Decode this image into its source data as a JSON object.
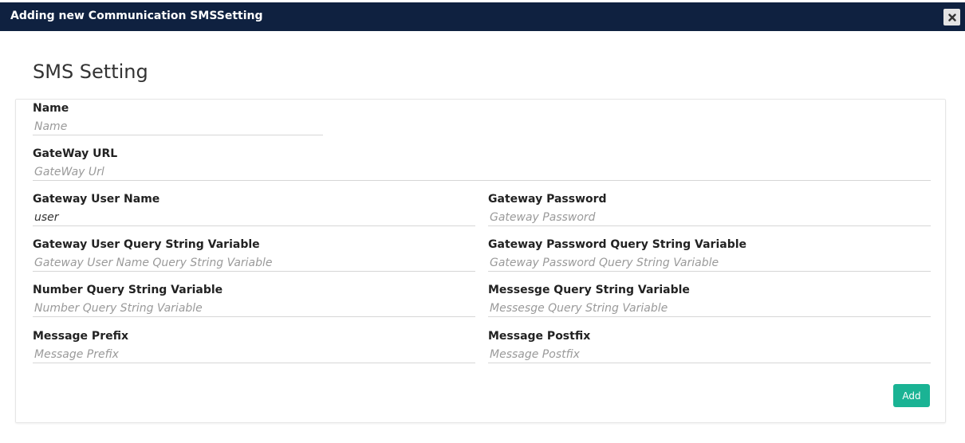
{
  "dialog": {
    "title": "Adding new Communication SMSSetting",
    "close_icon": "close-icon"
  },
  "page_title": "SMS Setting",
  "form": {
    "name": {
      "label": "Name",
      "value": "",
      "placeholder": "Name"
    },
    "gateway_url": {
      "label": "GateWay URL",
      "value": "",
      "placeholder": "GateWay Url"
    },
    "gateway_user_name": {
      "label": "Gateway User Name",
      "value": "user",
      "placeholder": ""
    },
    "gateway_password": {
      "label": "Gateway Password",
      "value": "",
      "placeholder": "Gateway Password"
    },
    "gateway_user_query": {
      "label": "Gateway User Query String Variable",
      "value": "",
      "placeholder": "Gateway User Name Query String Variable"
    },
    "gateway_password_query": {
      "label": "Gateway Password Query String Variable",
      "value": "",
      "placeholder": "Gateway Password Query String Variable"
    },
    "number_query": {
      "label": "Number Query String Variable",
      "value": "",
      "placeholder": "Number Query String Variable"
    },
    "message_query": {
      "label": "Messesge Query String Variable",
      "value": "",
      "placeholder": "Messesge Query String Variable"
    },
    "message_prefix": {
      "label": "Message Prefix",
      "value": "",
      "placeholder": "Message Prefix"
    },
    "message_postfix": {
      "label": "Message Postfix",
      "value": "",
      "placeholder": "Message Postfix"
    }
  },
  "actions": {
    "add_label": "Add"
  },
  "colors": {
    "titlebar": "#0f2140",
    "accent": "#1ab394"
  }
}
